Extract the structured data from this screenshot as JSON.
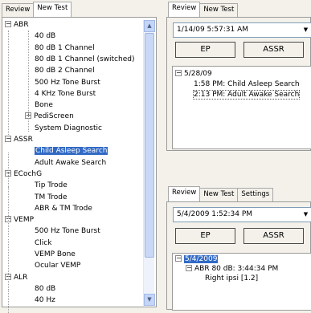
{
  "left": {
    "tabs": [
      "Review",
      "New Test"
    ],
    "tree": [
      {
        "text": "ABR",
        "expander": "−"
      },
      {
        "text": "40 dB"
      },
      {
        "text": "80 dB 1 Channel"
      },
      {
        "text": "80 dB 1 Channel (switched)"
      },
      {
        "text": "80 dB 2 Channel"
      },
      {
        "text": "500 Hz Tone Burst"
      },
      {
        "text": "4 KHz Tone Burst"
      },
      {
        "text": "Bone"
      },
      {
        "text": "PediScreen",
        "expander": "+"
      },
      {
        "text": "System Diagnostic"
      },
      {
        "text": "ASSR",
        "expander": "−"
      },
      {
        "text": "Child Asleep Search",
        "selected": true
      },
      {
        "text": "Adult Awake Search"
      },
      {
        "text": "ECochG",
        "expander": "−"
      },
      {
        "text": "Tip Trode"
      },
      {
        "text": "TM Trode"
      },
      {
        "text": "ABR & TM Trode"
      },
      {
        "text": "VEMP",
        "expander": "−"
      },
      {
        "text": "500 Hz Tone Burst"
      },
      {
        "text": "Click"
      },
      {
        "text": "VEMP Bone"
      },
      {
        "text": "Ocular VEMP"
      },
      {
        "text": "ALR",
        "expander": "−"
      },
      {
        "text": "80 dB"
      },
      {
        "text": "40 Hz"
      }
    ]
  },
  "top_right": {
    "tabs": [
      "Review",
      "New Test"
    ],
    "combo_value": "1/14/09 5:57:31 AM",
    "buttons": [
      "EP",
      "ASSR"
    ],
    "tree": [
      {
        "text": "5/28/09",
        "expander": "−"
      },
      {
        "text": "1:58 PM: Child Asleep Search"
      },
      {
        "text": "2:13 PM: Adult Awake Search",
        "focused": true
      }
    ]
  },
  "bottom_right": {
    "tabs": [
      "Review",
      "New Test",
      "Settings"
    ],
    "combo_value": "5/4/2009 1:52:34 PM",
    "buttons": [
      "EP",
      "ASSR"
    ],
    "tree": [
      {
        "text": "5/4/2009",
        "expander": "−",
        "selected": true
      },
      {
        "text": "ABR 80 dB: 3:44:34 PM",
        "expander": "−"
      },
      {
        "text": "Right ipsi [1.2]"
      }
    ]
  },
  "icons": {
    "dropdown": "▼",
    "scroll_up": "▲",
    "scroll_down": "▼"
  }
}
